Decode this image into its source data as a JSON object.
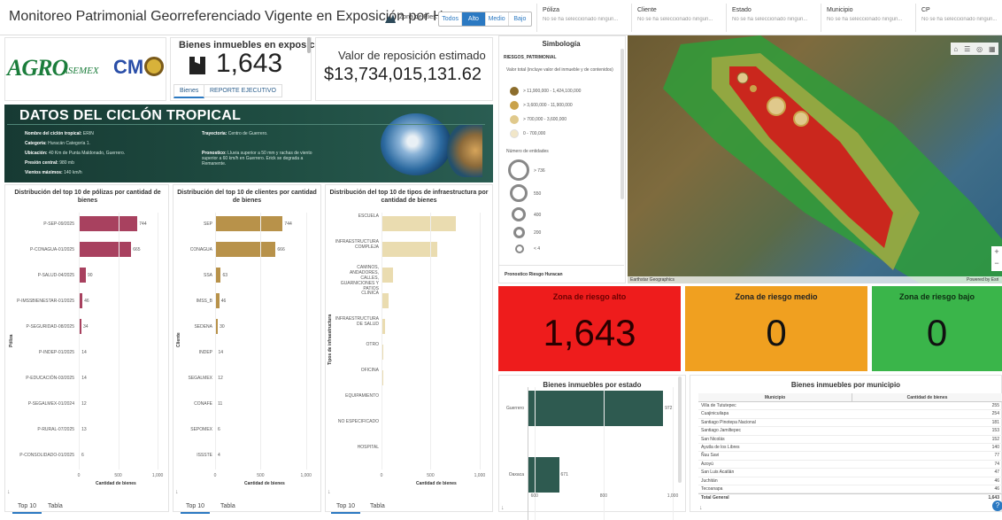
{
  "header": {
    "title": "Monitoreo Patrimonial Georreferenciado Vigente en Exposición por Huracán",
    "title_display": "Monitoreo Patrimonial Georreferenciado Vigente en Exposición por Hurac...",
    "zone_label": "Zona de Ries...",
    "zone_options": [
      "Todos",
      "Alto",
      "Medio",
      "Bajo"
    ],
    "zone_selected": "Alto",
    "filters": [
      {
        "label": "Póliza",
        "value": "No se ha seleccionado ningun..."
      },
      {
        "label": "Cliente",
        "value": "No se ha seleccionado ningun..."
      },
      {
        "label": "Estado",
        "value": "No se ha seleccionado ningun..."
      },
      {
        "label": "Municipio",
        "value": "No se ha seleccionado ningun..."
      },
      {
        "label": "CP",
        "value": "No se ha seleccionado ningun..."
      }
    ]
  },
  "logos": {
    "agro": "AGRO",
    "asemex": "ASEMEX",
    "cm": "CM"
  },
  "kpis": {
    "bienes_title": "Bienes inmuebles en exposición",
    "bienes_value": "1,643",
    "tabs": [
      "Bienes",
      "REPORTE EJECUTIVO"
    ],
    "reposicion_title": "Valor de reposición estimado",
    "reposicion_value": "$13,734,015,131.62"
  },
  "cyclone": {
    "title": "DATOS DEL CICLÓN TROPICAL",
    "left": [
      {
        "label": "Nombre del ciclón tropical:",
        "value": "ERIN"
      },
      {
        "label": "Categoría:",
        "value": "Huracán Categoría 1."
      },
      {
        "label": "Ubicación:",
        "value": "40 Km de Punta Maldonado, Guerrero."
      },
      {
        "label": "Presión central:",
        "value": "980 mb"
      },
      {
        "label": "Vientos máximos:",
        "value": "140 km/h"
      }
    ],
    "right": [
      {
        "label": "Trayectoria:",
        "value": "Centro de Guerrero."
      },
      {
        "label": "Pronostico:",
        "value": "Lluvia superior a 50 mm y rachas de viento superior a 60 km/h en Guerrero. Erick se degrada a Remanente."
      }
    ]
  },
  "charts": {
    "polizas": {
      "title": "Distribución del top 10 de pólizas por cantidad de bienes",
      "ylabel": "Póliza",
      "xlabel": "Cantidad de bienes",
      "xticks": [
        "0",
        "500",
        "1,000"
      ],
      "color": "#a8415f",
      "tabs": [
        "Top 10",
        "Tabla"
      ]
    },
    "clientes": {
      "title": "Distribución del top 10 de clientes por cantidad de bienes",
      "ylabel": "Cliente",
      "xlabel": "Cantidad de bienes",
      "xticks": [
        "0",
        "500",
        "1,000"
      ],
      "color": "#b8924a",
      "tabs": [
        "Top 10",
        "Tabla"
      ]
    },
    "infra": {
      "title": "Distribución del top 10 de tipos de infraestructura por cantidad de bienes",
      "ylabel": "Tipos de infraestructura",
      "xlabel": "Cantidad de bienes",
      "xticks": [
        "0",
        "500",
        "1,000"
      ],
      "color": "#eadcb0",
      "tabs": [
        "Top 10",
        "Tabla"
      ]
    },
    "estado": {
      "title": "Bienes inmuebles por estado",
      "xticks": [
        "600",
        "800",
        "1,000"
      ],
      "color": "#2e5a50"
    }
  },
  "chart_data": [
    {
      "type": "bar",
      "title": "Distribución del top 10 de pólizas por cantidad de bienes",
      "categories": [
        "P-SEP-09/2025",
        "P-CONAGUA-01/2025",
        "P-SALUD-04/2025",
        "P-IMSSBIENESTAR-01/2025",
        "P-SEGURIDAD-08/2025",
        "P-INDEP-01/2025",
        "P-EDUCACIÓN-03/2025",
        "P-SEGALMEX-01/2024",
        "P-RURAL-07/2025",
        "P-CONSOLIDADO-01/2025"
      ],
      "values": [
        744,
        665,
        90,
        46,
        34,
        14,
        14,
        12,
        13,
        6
      ],
      "value_labels": [
        "744",
        "665",
        "90",
        "46",
        "34",
        "14",
        "14",
        "12",
        "13",
        "6"
      ],
      "xlabel": "Cantidad de bienes",
      "ylabel": "Póliza",
      "xlim": [
        0,
        1100
      ]
    },
    {
      "type": "bar",
      "title": "Distribución del top 10 de clientes por cantidad de bienes",
      "categories": [
        "SEP",
        "CONAGUA",
        "SSA",
        "IMSS_B",
        "SEDENA",
        "INDEP",
        "SEGALMEX",
        "CONAFE",
        "SEPOMEX",
        "ISSSTE"
      ],
      "values": [
        744,
        666,
        63,
        46,
        30,
        14,
        12,
        11,
        6,
        4
      ],
      "value_labels": [
        "744",
        "666",
        "63",
        "46",
        "30",
        "14",
        "12",
        "11",
        "6",
        "4"
      ],
      "xlabel": "Cantidad de bienes",
      "ylabel": "Cliente",
      "xlim": [
        0,
        1100
      ]
    },
    {
      "type": "bar",
      "title": "Distribución del top 10 de tipos de infraestructura por cantidad de bienes",
      "categories": [
        "ESCUELA",
        "INFRAESTRUCTURA COMPLEJA",
        "CAMINOS, ANDADORES, CALLES, GUARNICIONES Y PATIOS",
        "CLINICA",
        "INFRAESTRUCTURA DE SALUD",
        "OTRO",
        "OFICINA",
        "EQUIPAMIENTO",
        "NO ESPECIFICADO",
        "HOSPITAL"
      ],
      "values": [
        760,
        565,
        120,
        75,
        38,
        16,
        14,
        12,
        8,
        5
      ],
      "xlabel": "Cantidad de bienes",
      "ylabel": "Tipos de infraestructura",
      "xlim": [
        0,
        1100
      ]
    },
    {
      "type": "bar",
      "title": "Bienes inmuebles por estado",
      "categories": [
        "Guerrero",
        "Oaxaca"
      ],
      "values": [
        972,
        671
      ],
      "value_labels": [
        "972",
        "671"
      ],
      "xlim": [
        580,
        1000
      ]
    }
  ],
  "symbology": {
    "title": "Simbología",
    "layer": "RIESGOS_PATRIMONIAL",
    "value_title": "Valor total (incluye valor del inmueble y de contenidos)",
    "classes": [
      {
        "label": "> 11,900,000 - 1,424,100,000",
        "color": "#8c6d2c"
      },
      {
        "label": "> 3,600,000 - 11,900,000",
        "color": "#c9a24a"
      },
      {
        "label": "> 700,000 - 3,600,000",
        "color": "#e0c98c"
      },
      {
        "label": "0 - 700,000",
        "color": "#f1e6c8"
      }
    ],
    "count_title": "Número de entidades",
    "sizes": [
      "> 736",
      "550",
      "400",
      "200",
      "< 4"
    ],
    "footer": "Pronostico Riesgo Huracan"
  },
  "map": {
    "attribution": "Earthstar Geographics",
    "powered": "Powered by Esri"
  },
  "zones": [
    {
      "title": "Zona de riesgo alto",
      "value": "1,643",
      "bg": "#ee1c1c",
      "title_color": "#6b0000",
      "num_color": "#2a0000"
    },
    {
      "title": "Zona de riesgo medio",
      "value": "0",
      "bg": "#f0a020",
      "title_color": "#222",
      "num_color": "#111"
    },
    {
      "title": "Zona de riesgo bajo",
      "value": "0",
      "bg": "#3ab54a",
      "title_color": "#0e2e12",
      "num_color": "#111"
    }
  ],
  "municipio_table": {
    "title": "Bienes inmuebles por municipio",
    "columns": [
      "Municipio",
      "Cantidad de bienes"
    ],
    "rows": [
      [
        "Villa de Tututepec",
        "255"
      ],
      [
        "Cuajinicuilapa",
        "254"
      ],
      [
        "Santiago Pinotepa Nacional",
        "181"
      ],
      [
        "Santiago Jamiltepec",
        "153"
      ],
      [
        "San Nicolás",
        "152"
      ],
      [
        "Ayutla de los Libres",
        "140"
      ],
      [
        "Ñuu Savi",
        "77"
      ],
      [
        "Azoyú",
        "74"
      ],
      [
        "San Luis Acatlán",
        "47"
      ],
      [
        "Juchitán",
        "46"
      ],
      [
        "Tecoanapa",
        "46"
      ]
    ],
    "total_label": "Total General",
    "total_value": "1,643"
  }
}
